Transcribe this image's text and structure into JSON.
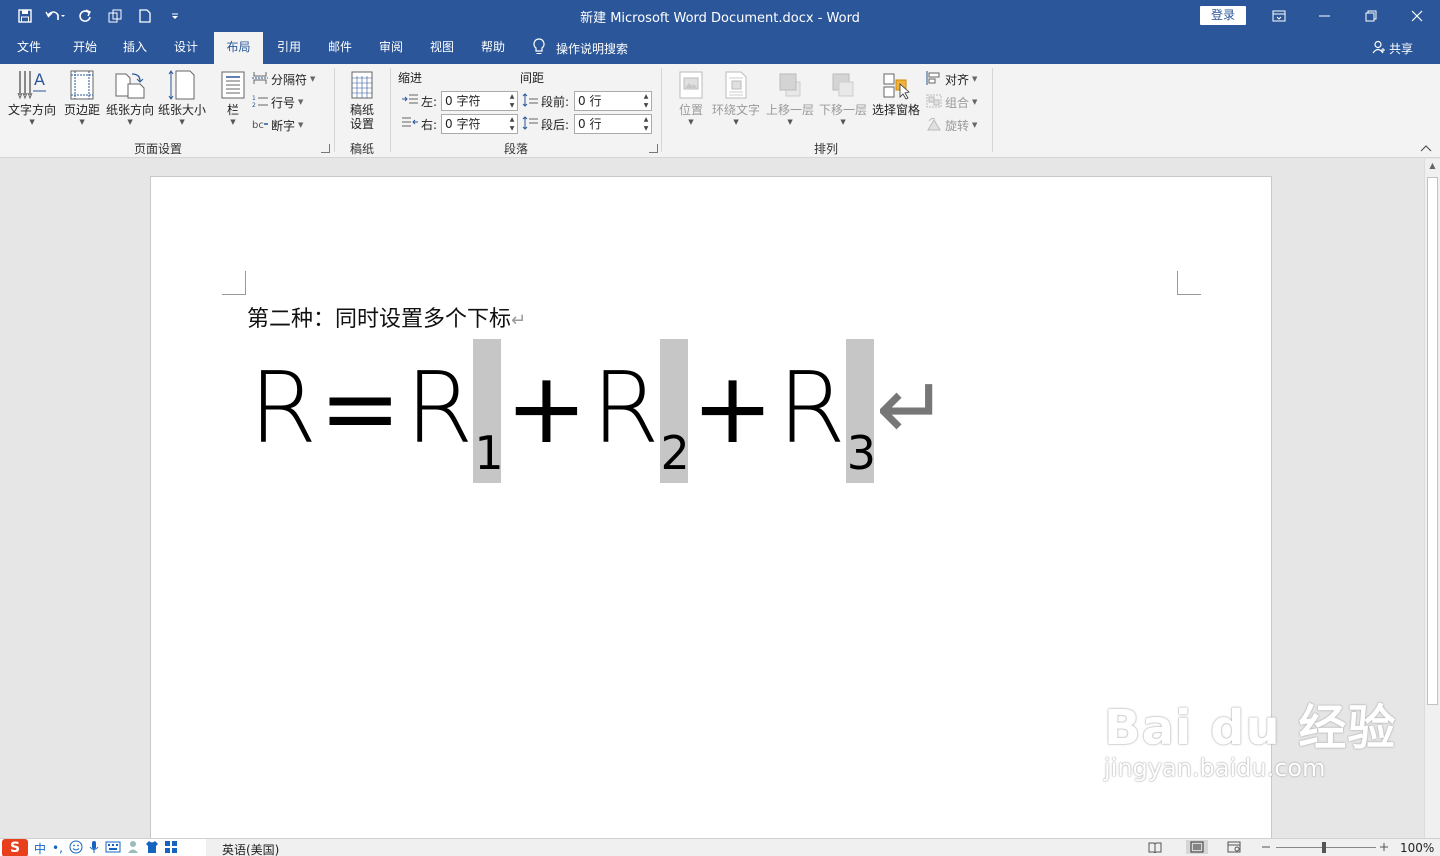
{
  "window": {
    "title": "新建 Microsoft Word Document.docx  -  Word",
    "login_label": "登录"
  },
  "tabs": [
    {
      "label": "文件"
    },
    {
      "label": "开始"
    },
    {
      "label": "插入"
    },
    {
      "label": "设计"
    },
    {
      "label": "布局",
      "active": true
    },
    {
      "label": "引用"
    },
    {
      "label": "邮件"
    },
    {
      "label": "审阅"
    },
    {
      "label": "视图"
    },
    {
      "label": "帮助"
    }
  ],
  "tellme_label": "操作说明搜索",
  "share_label": "共享",
  "ribbon": {
    "page_setup": {
      "group_label": "页面设置",
      "text_direction": "文字方向",
      "margins": "页边距",
      "orientation": "纸张方向",
      "size": "纸张大小",
      "columns": "栏",
      "breaks": "分隔符",
      "line_numbers": "行号",
      "hyphenation": "断字"
    },
    "manuscript": {
      "group_label": "稿纸",
      "button_line1": "稿纸",
      "button_line2": "设置"
    },
    "paragraph": {
      "group_label": "段落",
      "indent_header": "缩进",
      "spacing_header": "间距",
      "left_label": "左:",
      "right_label": "右:",
      "before_label": "段前:",
      "after_label": "段后:",
      "left_value": "0 字符",
      "right_value": "0 字符",
      "before_value": "0 行",
      "after_value": "0 行"
    },
    "arrange": {
      "group_label": "排列",
      "position": "位置",
      "wrap_text": "环绕文字",
      "bring_forward": "上移一层",
      "send_backward": "下移一层",
      "selection_pane": "选择窗格",
      "align": "对齐",
      "group": "组合",
      "rotate": "旋转"
    }
  },
  "document": {
    "line1": "第二种：同时设置多个下标",
    "pilcrow": "↵",
    "formula": {
      "lhs": "R",
      "equals": "=",
      "plus": "+",
      "terms": [
        {
          "base": "R",
          "sub": "1"
        },
        {
          "base": "R",
          "sub": "2"
        },
        {
          "base": "R",
          "sub": "3"
        }
      ],
      "return_mark": "↵"
    }
  },
  "watermark": {
    "brand": "Bai du 经验",
    "url": "jingyan.baidu.com"
  },
  "status": {
    "ime_logo": "S",
    "ime_mode": "中",
    "ime_punct": "•,",
    "language": "英语(美国)",
    "zoom": "100%"
  }
}
